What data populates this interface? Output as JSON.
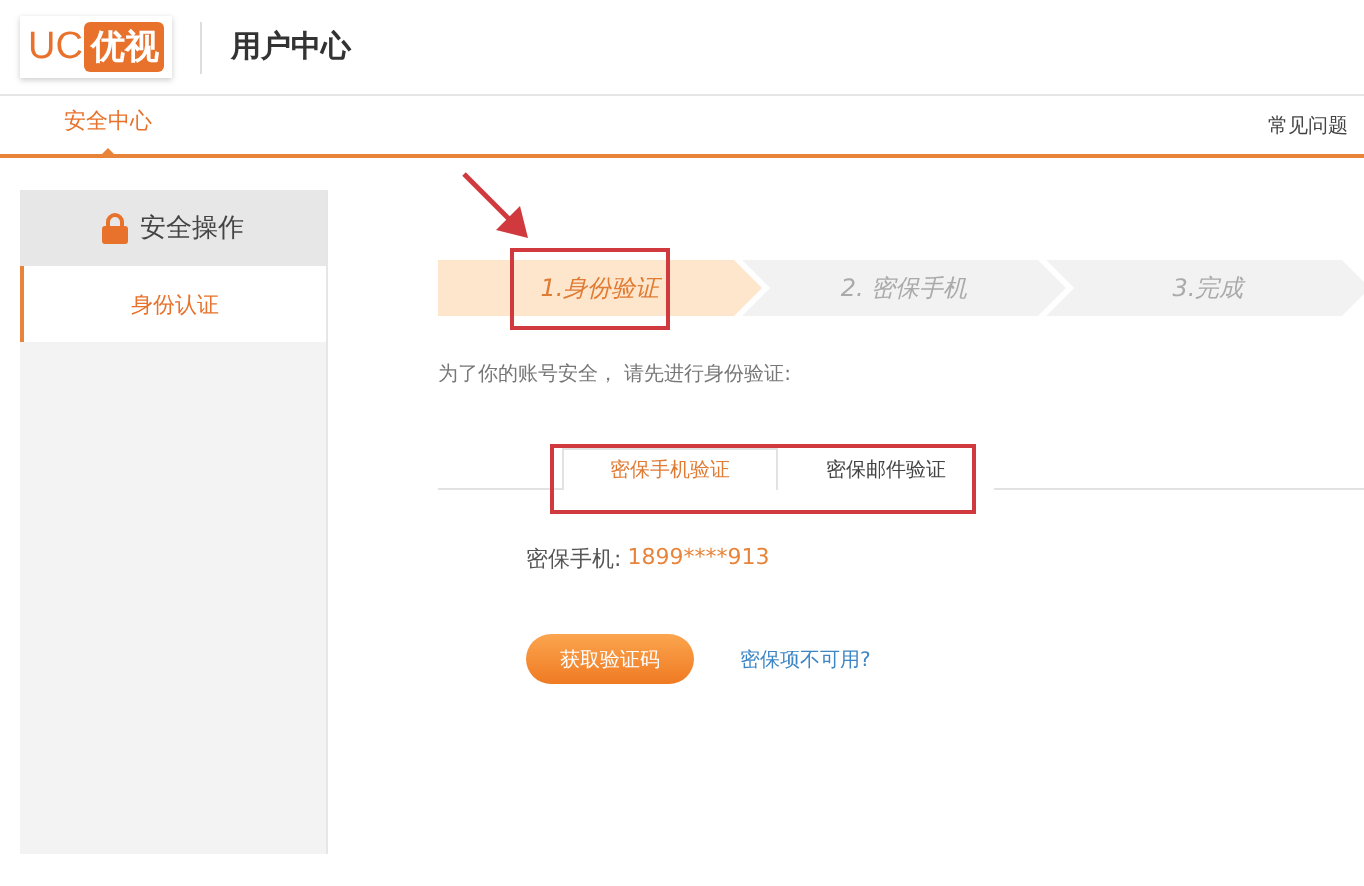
{
  "header": {
    "logo": {
      "latin": "UC",
      "badge": "优视"
    },
    "title": "用户中心"
  },
  "nav": {
    "tabs": [
      {
        "label": "安全中心",
        "selected": true
      }
    ],
    "help_link": "常见问题"
  },
  "sidebar": {
    "heading": "安全操作",
    "items": [
      {
        "label": "身份认证",
        "selected": true
      }
    ]
  },
  "steps": [
    {
      "label": "1.身份验证",
      "selected": true
    },
    {
      "label": "2. 密保手机",
      "selected": false
    },
    {
      "label": "3.完成",
      "selected": false
    }
  ],
  "intro": "为了你的账号安全， 请先进行身份验证:",
  "method_tabs": [
    {
      "label": "密保手机验证",
      "selected": true
    },
    {
      "label": "密保邮件验证",
      "selected": false
    }
  ],
  "phone": {
    "label": "密保手机:",
    "value": "1899****913"
  },
  "get_code_button": "获取验证码",
  "unavailable_link": "密保项不可用?",
  "annotations": [
    {
      "kind": "arrow"
    },
    {
      "kind": "frame"
    },
    {
      "kind": "frame"
    }
  ]
}
